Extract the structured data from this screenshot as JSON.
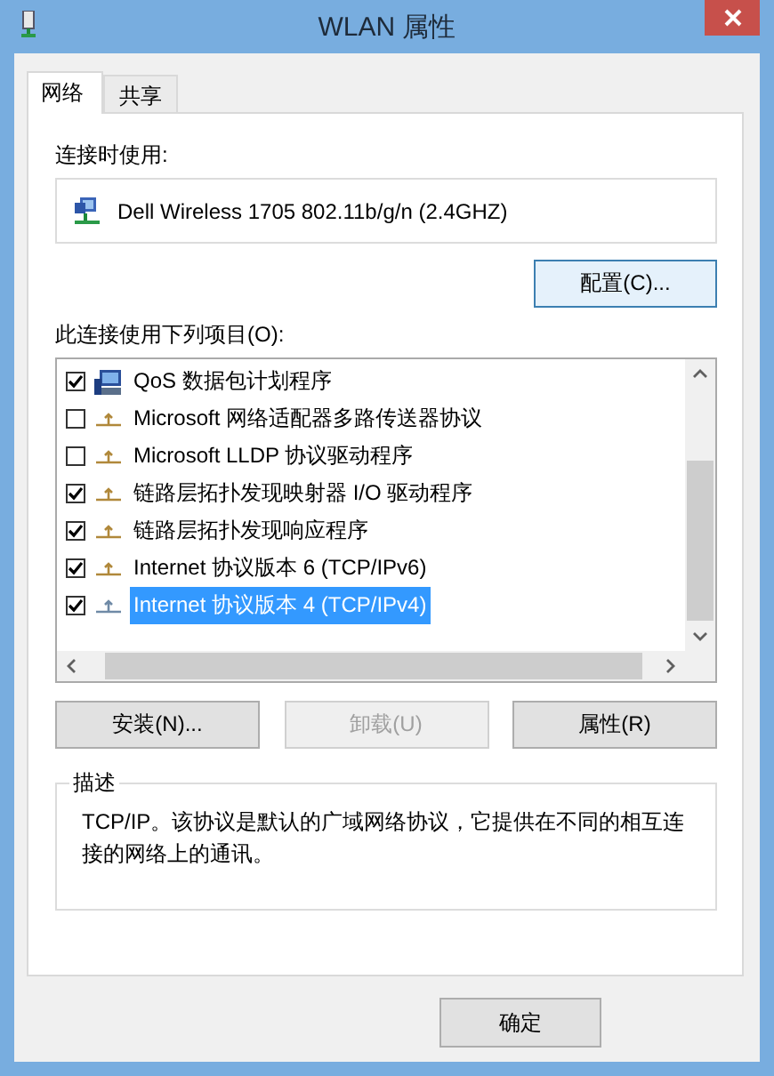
{
  "window": {
    "title": "WLAN 属性"
  },
  "tabs": [
    {
      "label": "网络",
      "selected": true
    },
    {
      "label": "共享",
      "selected": false
    }
  ],
  "connect_using": {
    "label": "连接时使用:",
    "adapter": "Dell Wireless 1705 802.11b/g/n (2.4GHZ)",
    "configure_button": "配置(C)..."
  },
  "components": {
    "label": "此连接使用下列项目(O):",
    "items": [
      {
        "label": "QoS 数据包计划程序",
        "kind": "service",
        "checked": true,
        "selected": false
      },
      {
        "label": "Microsoft 网络适配器多路传送器协议",
        "kind": "protocol",
        "checked": false,
        "selected": false
      },
      {
        "label": "Microsoft LLDP 协议驱动程序",
        "kind": "protocol",
        "checked": false,
        "selected": false
      },
      {
        "label": "链路层拓扑发现映射器 I/O 驱动程序",
        "kind": "protocol",
        "checked": true,
        "selected": false
      },
      {
        "label": "链路层拓扑发现响应程序",
        "kind": "protocol",
        "checked": true,
        "selected": false
      },
      {
        "label": "Internet 协议版本 6 (TCP/IPv6)",
        "kind": "protocol",
        "checked": true,
        "selected": false
      },
      {
        "label": "Internet 协议版本 4 (TCP/IPv4)",
        "kind": "protocol",
        "checked": true,
        "selected": true
      }
    ]
  },
  "buttons": [
    {
      "label": "安装(N)...",
      "disabled": false
    },
    {
      "label": "卸载(U)",
      "disabled": true
    },
    {
      "label": "属性(R)",
      "disabled": false
    }
  ],
  "description": {
    "label": "描述",
    "text": "TCP/IP。该协议是默认的广域网络协议，它提供在不同的相互连接的网络上的通讯。"
  },
  "footer_buttons": [
    {
      "label": "确定"
    }
  ]
}
